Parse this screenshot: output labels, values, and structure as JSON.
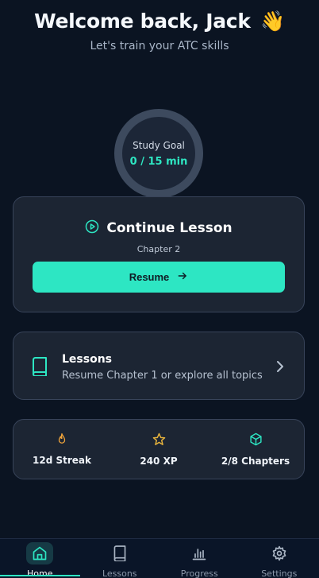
{
  "header": {
    "title": "Welcome back, Jack",
    "wave_emoji": "👋",
    "subtitle": "Let's train your ATC skills"
  },
  "study_goal": {
    "label": "Study Goal",
    "value": "0 / 15 min",
    "progress_fraction": 0.0
  },
  "continue_lesson": {
    "title": "Continue Lesson",
    "subtitle": "Chapter 2",
    "button_label": "Resume",
    "icon": "play-circle-icon"
  },
  "lessons": {
    "title": "Lessons",
    "description": "Resume Chapter 1 or explore all topics",
    "icon": "book-icon"
  },
  "stats": [
    {
      "label": "12d Streak",
      "icon": "flame-icon"
    },
    {
      "label": "240 XP",
      "icon": "star-icon"
    },
    {
      "label": "2/8 Chapters",
      "icon": "cube-icon"
    }
  ],
  "nav": [
    {
      "label": "Home",
      "icon": "home-icon",
      "active": true
    },
    {
      "label": "Lessons",
      "icon": "book-icon",
      "active": false
    },
    {
      "label": "Progress",
      "icon": "bar-chart-icon",
      "active": false
    },
    {
      "label": "Settings",
      "icon": "gear-icon",
      "active": false
    }
  ],
  "colors": {
    "background": "#0b1422",
    "accent": "#2de6c3",
    "stat_icon_orange": "#f0a43a",
    "stat_icon_yellow": "#e9b53c",
    "stat_icon_teal": "#2de6c3",
    "card": "#1c2533"
  }
}
